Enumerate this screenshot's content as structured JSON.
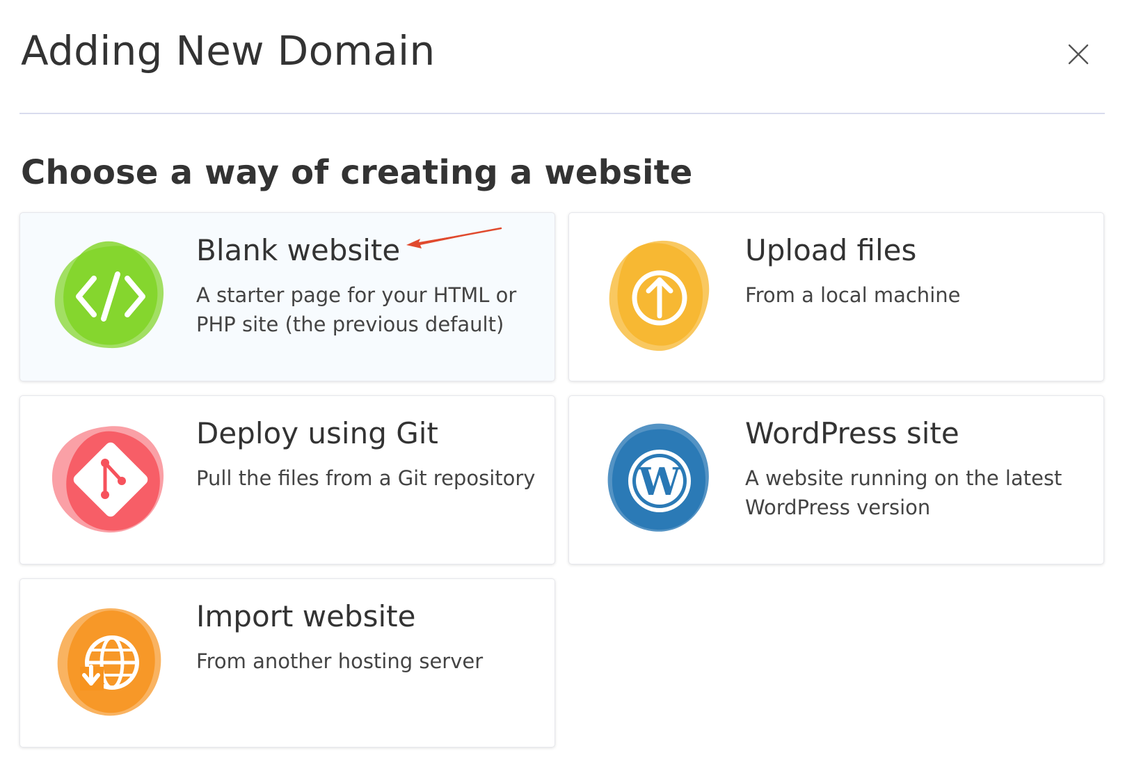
{
  "dialog": {
    "title": "Adding New Domain",
    "close_glyph": "×"
  },
  "section": {
    "title": "Choose a way of creating a website"
  },
  "cards": [
    {
      "title": "Blank website",
      "description": "A starter page for your HTML or PHP site (the previous default)",
      "icon": "code-icon",
      "color": "#7ed321",
      "selected": true
    },
    {
      "title": "Upload files",
      "description": "From a local machine",
      "icon": "upload-icon",
      "color": "#f7b52b"
    },
    {
      "title": "Deploy using Git",
      "description": "Pull the files from a Git repository",
      "icon": "git-icon",
      "color": "#f6525c"
    },
    {
      "title": "WordPress site",
      "description": "A website running on the latest WordPress version",
      "icon": "wordpress-icon",
      "color": "#2978b5"
    },
    {
      "title": "Import website",
      "description": "From another hosting server",
      "icon": "import-globe-icon",
      "color": "#f7931e"
    }
  ],
  "annotation": {
    "arrow_color": "#e04a2e"
  }
}
